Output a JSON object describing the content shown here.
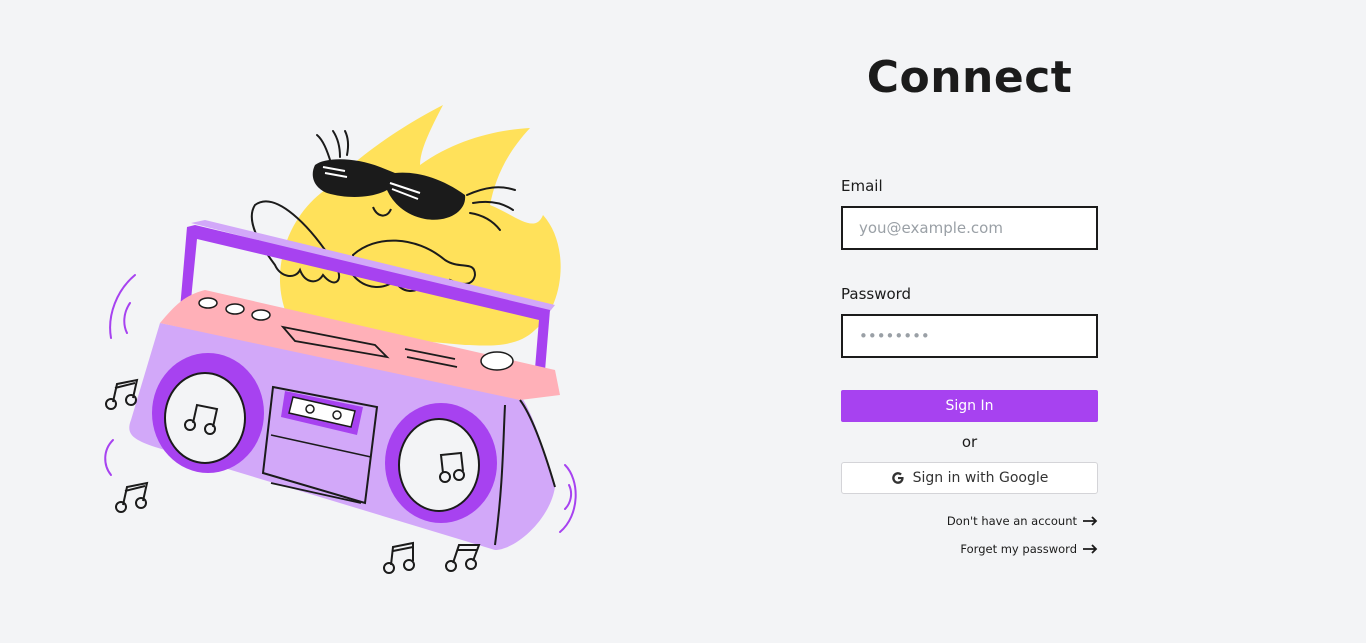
{
  "page": {
    "title": "Connect"
  },
  "form": {
    "email_label": "Email",
    "email_placeholder": "you@example.com",
    "email_value": "",
    "password_label": "Password",
    "password_placeholder": "••••••••",
    "password_value": "",
    "sign_in_label": "Sign In",
    "or_label": "or",
    "google_label": "Sign in with Google",
    "no_account_link": "Don't have an account",
    "forgot_link": "Forget my password"
  },
  "colors": {
    "background": "#f3f4f6",
    "accent": "#a742f0",
    "text": "#1b1b1b",
    "illustration_yellow": "#ffe15a",
    "illustration_purple": "#a742f0",
    "illustration_lilac": "#d2a8f9",
    "illustration_pink": "#ffb0b8"
  },
  "icons": {
    "google": "google-g-icon",
    "arrow": "arrow-right-icon"
  }
}
